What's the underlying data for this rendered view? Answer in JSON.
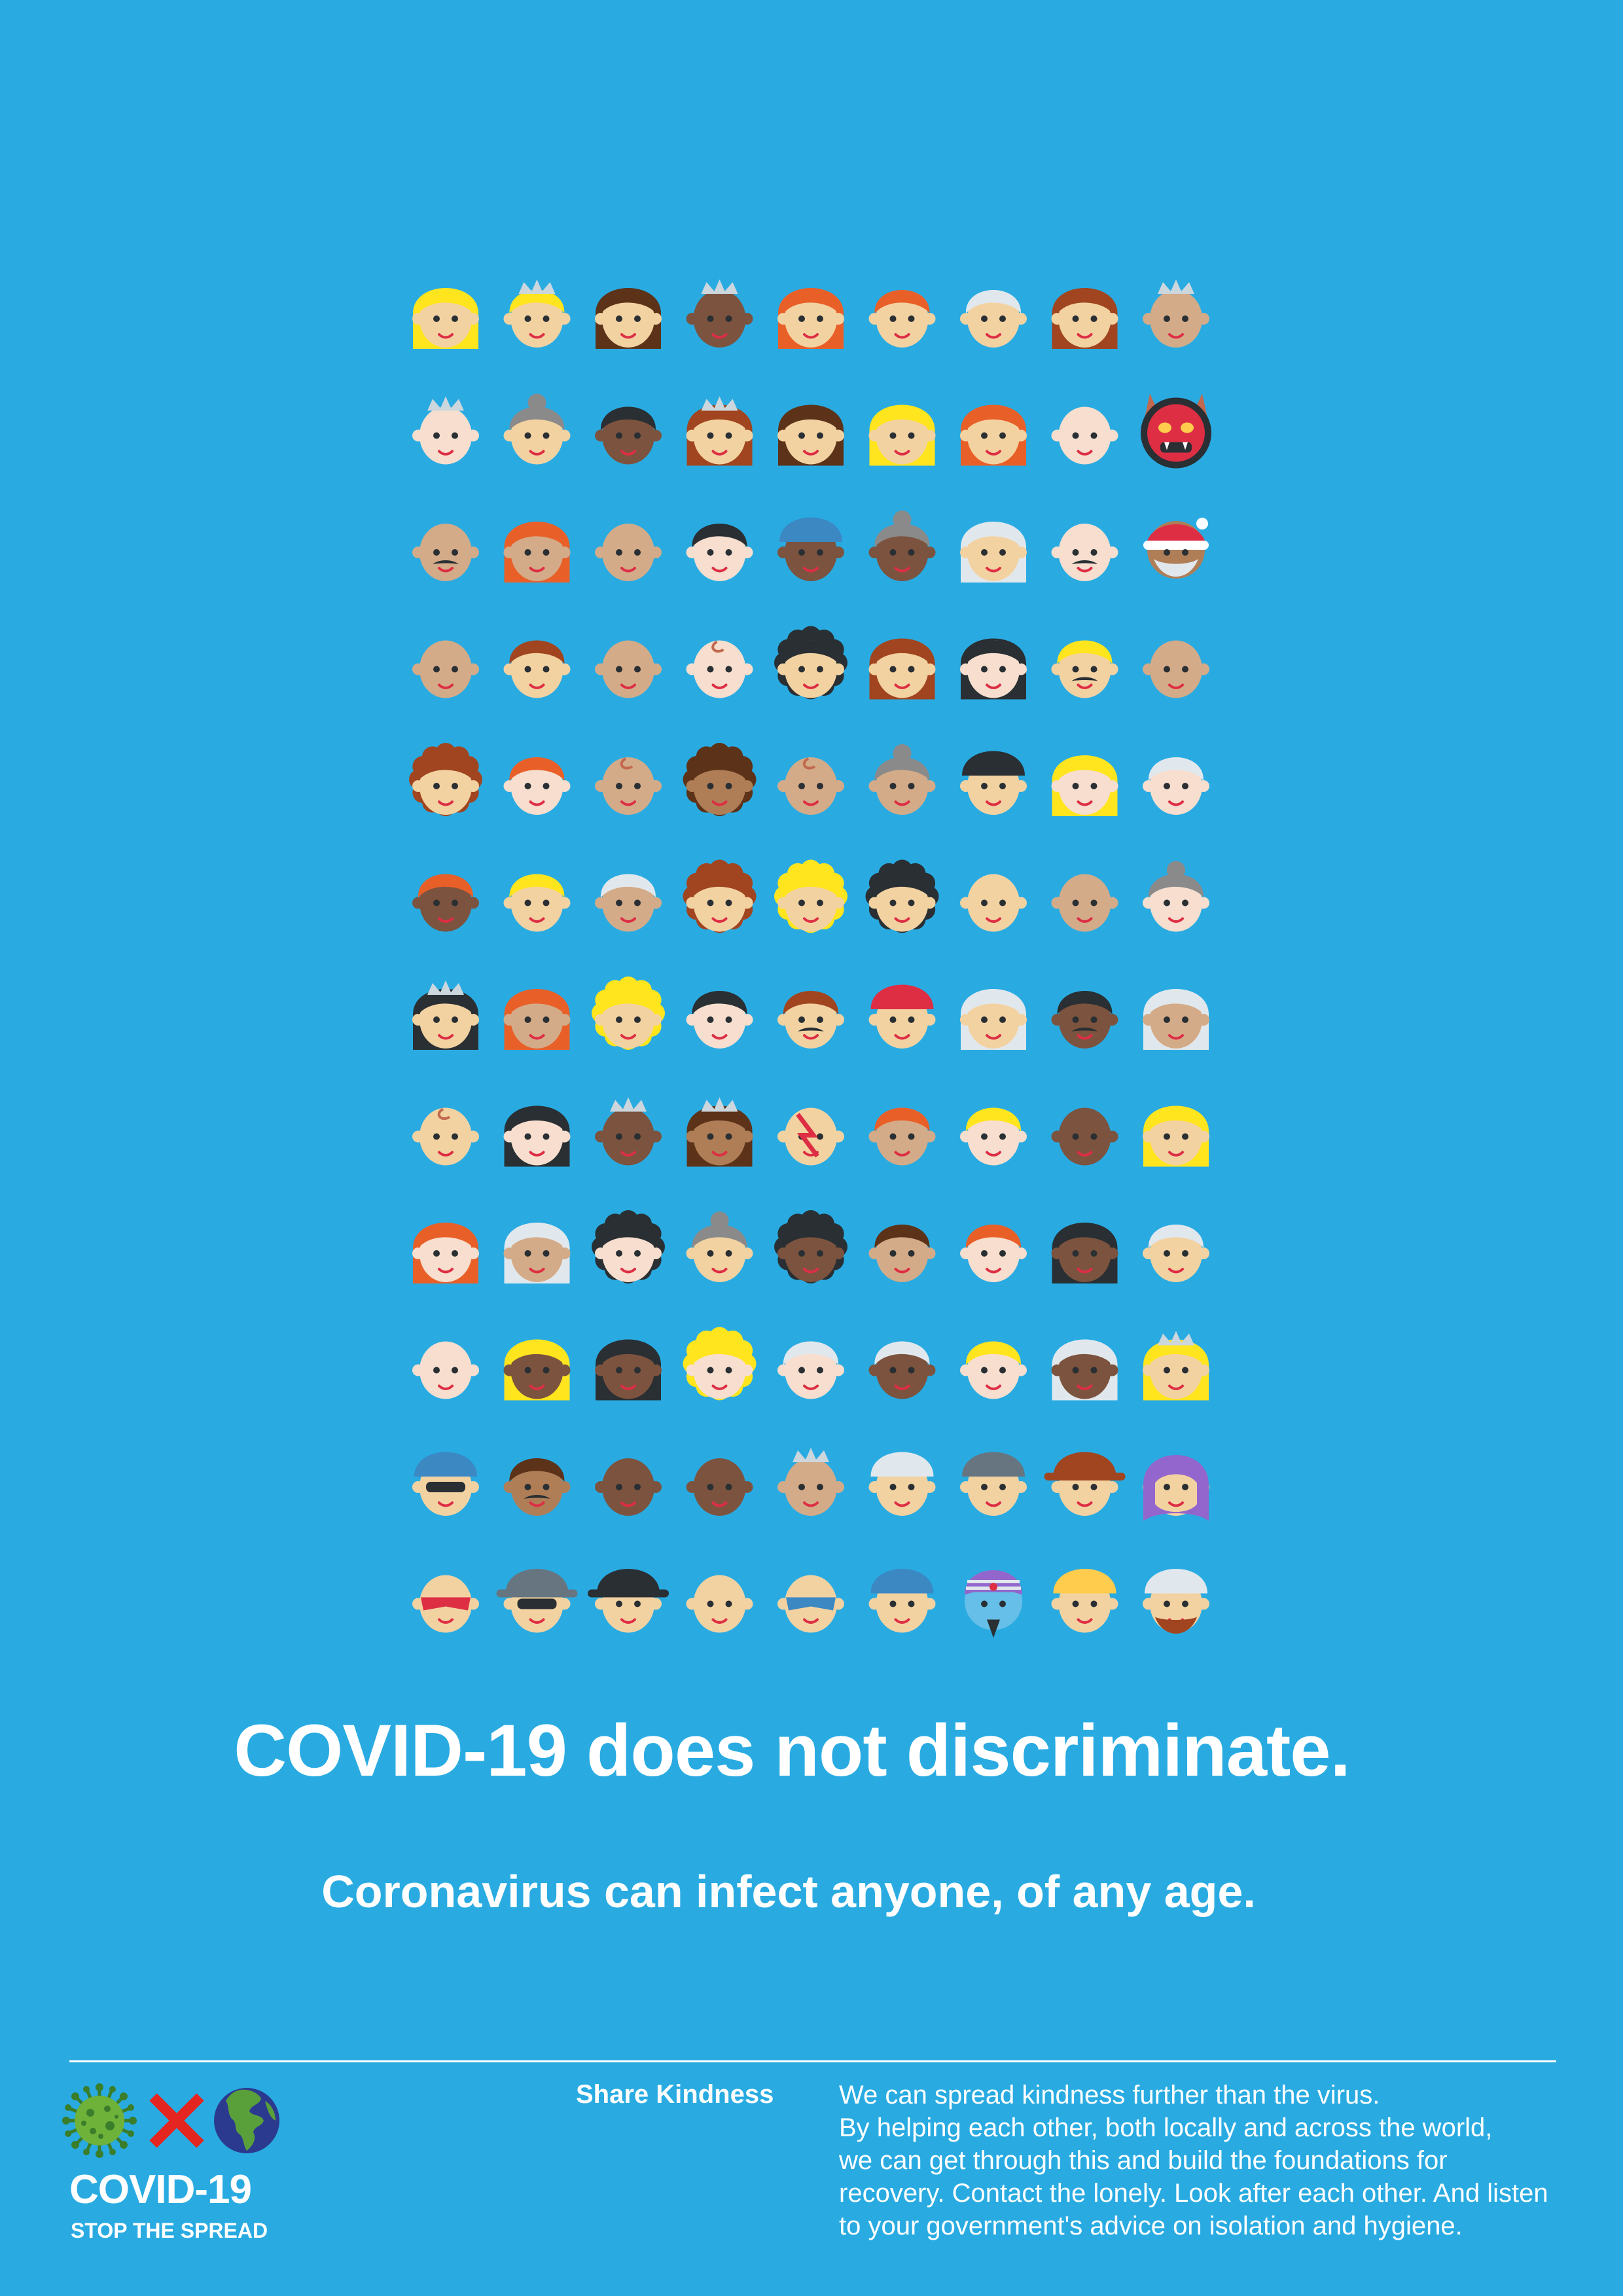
{
  "headline": "COVID-19 does not discriminate.",
  "subheadline": "Coronavirus can infect anyone, of any age.",
  "footer": {
    "logo": {
      "icons": [
        "virus-icon",
        "cross-icon",
        "globe-icon"
      ],
      "title": "COVID-19",
      "subtitle": "STOP THE SPREAD"
    },
    "label": "Share Kindness",
    "body_lines": [
      "We can spread kindness further than the virus.",
      "By helping each other, both locally and across the world,",
      "we can get through this and build the foundations for",
      "recovery. Contact the lonely. Look after each other. And listen",
      "to your government's advice on isolation and hygiene."
    ]
  },
  "colors": {
    "background": "#29abe2",
    "text": "#ffffff",
    "skin_tones": [
      "#f7dece",
      "#f3d2a2",
      "#d4ab88",
      "#af7e57",
      "#7c533e"
    ],
    "hair_colors": [
      "#ffe51e",
      "#e95f28",
      "#a0451f",
      "#5c3319",
      "#292f33",
      "#e1e8ed",
      "#8a8a8a"
    ]
  },
  "faces": [
    [
      "f-blonde-long-woman",
      "m-blonde-prince",
      "f-brown-hair-woman",
      "f-princess-dark",
      "f-ginger-woman",
      "m-ginger-man",
      "m-white-hair-man",
      "f-auburn-woman",
      "m-prince-tan"
    ],
    [
      "m-prince-light",
      "f-grey-bun-woman",
      "m-black-hair-dark",
      "f-princess-auburn",
      "f-brown-long-woman",
      "f-blonde-long-woman",
      "f-ginger-woman",
      "m-bald-light",
      "ogre-face"
    ],
    [
      "m-moustache-tan",
      "f-ginger-tan",
      "m-bald-tan",
      "m-black-hair-light",
      "m-cap-dark",
      "f-grey-bun-dark",
      "f-white-long-woman",
      "m-moustache-light",
      "santa-face"
    ],
    [
      "m-curly-tan",
      "m-auburn-man",
      "m-old-bald-tan",
      "baby-light",
      "f-curly-black",
      "f-auburn-woman",
      "f-black-long-light",
      "m-blonde-moustache",
      "m-bald-tan"
    ],
    [
      "f-curly-auburn",
      "m-ginger-light",
      "baby-tan",
      "f-curly-brown",
      "baby-tan",
      "f-grey-bun-tan",
      "m-police-officer",
      "f-blonde-light",
      "m-old-white-light"
    ],
    [
      "m-ginger-dark",
      "m-blonde-man",
      "m-white-hair-tan",
      "m-auburn-curly",
      "m-blonde-curly",
      "m-black-curly",
      "m-old-bald-cream",
      "m-bald-tan",
      "f-grey-bun-light"
    ],
    [
      "f-princess-black",
      "f-ginger-tan",
      "f-blonde-curly",
      "m-black-hair-light",
      "m-auburn-moustache",
      "m-firefighter",
      "f-white-long-woman",
      "m-black-moustache-dark",
      "f-white-long-tan"
    ],
    [
      "baby-cream",
      "f-black-long-light",
      "m-prince-dark",
      "f-princess-brown",
      "m-starpaint-face",
      "m-ginger-tan",
      "m-blonde-light",
      "m-bald-dark",
      "f-blonde-long-woman"
    ],
    [
      "f-ginger-long-light",
      "f-white-long-tan",
      "f-curly-black-light",
      "f-grey-bun-cream",
      "m-curly-black-dark",
      "m-brown-hair-tan",
      "m-ginger-light",
      "f-black-long-dark",
      "m-white-hair-cream"
    ],
    [
      "m-bald-light",
      "f-blonde-long-dark",
      "f-black-long-dark",
      "f-blonde-curly-light",
      "m-white-hair-light",
      "m-white-hair-dark",
      "m-blonde-light",
      "f-white-long-dark",
      "f-princess-blonde"
    ],
    [
      "m-construction-helmet-glasses",
      "m-moustache-brown",
      "m-bald-dark",
      "m-old-bald-dark",
      "m-prince-tan",
      "m-chef",
      "m-beret",
      "m-cowboy",
      "f-hijab"
    ],
    [
      "m-superhero-mask",
      "m-fedora-sunglasses",
      "f-graduate",
      "f-vampire",
      "m-ninja-mask",
      "m-blue-cap",
      "genie-face",
      "m-construction-worker",
      "m-turban"
    ]
  ]
}
